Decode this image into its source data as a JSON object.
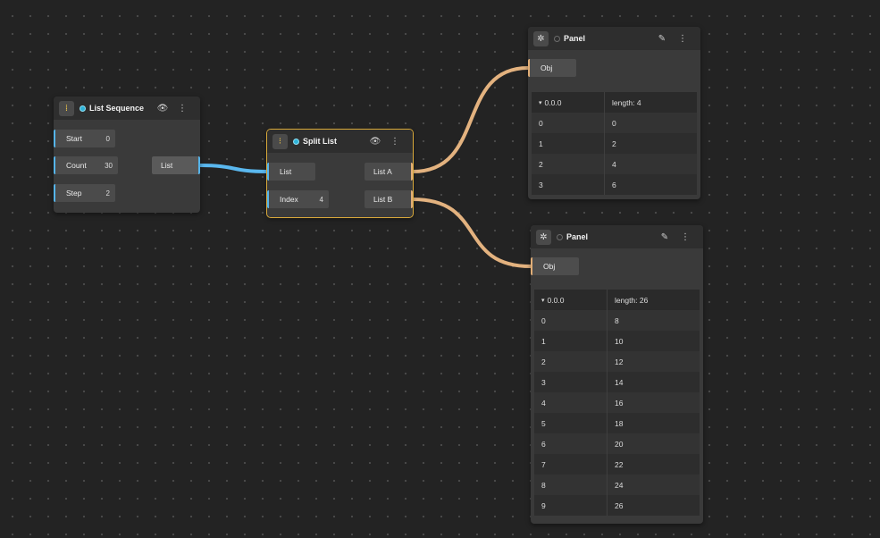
{
  "colors": {
    "wire_blue": "#5ab8ef",
    "wire_orange": "#e3b27f",
    "selection": "#d9a93a",
    "status_on": "#2fb3d8"
  },
  "list_sequence": {
    "title": "List Sequence",
    "icon": "list-sequence-icon",
    "inputs": [
      {
        "label": "Start",
        "value": "0"
      },
      {
        "label": "Count",
        "value": "30"
      },
      {
        "label": "Step",
        "value": "2"
      }
    ],
    "output": {
      "label": "List"
    }
  },
  "split_list": {
    "title": "Split List",
    "icon": "split-list-icon",
    "inputs": [
      {
        "label": "List",
        "value": ""
      },
      {
        "label": "Index",
        "value": "4"
      }
    ],
    "outputs": [
      {
        "label": "List A"
      },
      {
        "label": "List B"
      }
    ]
  },
  "panel_a": {
    "title": "Panel",
    "icon": "bug-icon",
    "input_label": "Obj",
    "header": {
      "path": "0.0.0",
      "length": "length: 4"
    },
    "rows": [
      {
        "index": "0",
        "value": "0"
      },
      {
        "index": "1",
        "value": "2"
      },
      {
        "index": "2",
        "value": "4"
      },
      {
        "index": "3",
        "value": "6"
      }
    ]
  },
  "panel_b": {
    "title": "Panel",
    "icon": "bug-icon",
    "input_label": "Obj",
    "header": {
      "path": "0.0.0",
      "length": "length: 26"
    },
    "rows": [
      {
        "index": "0",
        "value": "8"
      },
      {
        "index": "1",
        "value": "10"
      },
      {
        "index": "2",
        "value": "12"
      },
      {
        "index": "3",
        "value": "14"
      },
      {
        "index": "4",
        "value": "16"
      },
      {
        "index": "5",
        "value": "18"
      },
      {
        "index": "6",
        "value": "20"
      },
      {
        "index": "7",
        "value": "22"
      },
      {
        "index": "8",
        "value": "24"
      },
      {
        "index": "9",
        "value": "26"
      }
    ]
  }
}
